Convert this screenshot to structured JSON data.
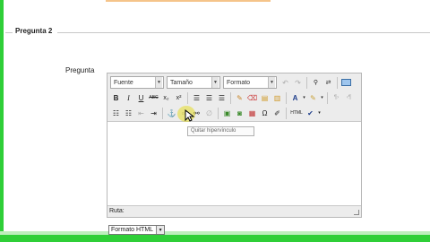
{
  "section": {
    "legend": "Pregunta 2"
  },
  "question": {
    "label": "Pregunta"
  },
  "toolbar": {
    "font_select": "Fuente",
    "size_select": "Tamaño",
    "format_select": "Formato",
    "bold": "B",
    "italic": "I",
    "underline": "U",
    "strike": "ABC",
    "subscript": "x₂",
    "superscript": "x²",
    "unlink_tooltip": "Quitar hipervínculo",
    "html_label": "HTML"
  },
  "statusbar": {
    "path_label": "Ruta:"
  },
  "text_format": {
    "selected": "Formato HTML"
  },
  "colors": {
    "accent_green": "#2fcf38",
    "highlight": "#e6dc28"
  }
}
